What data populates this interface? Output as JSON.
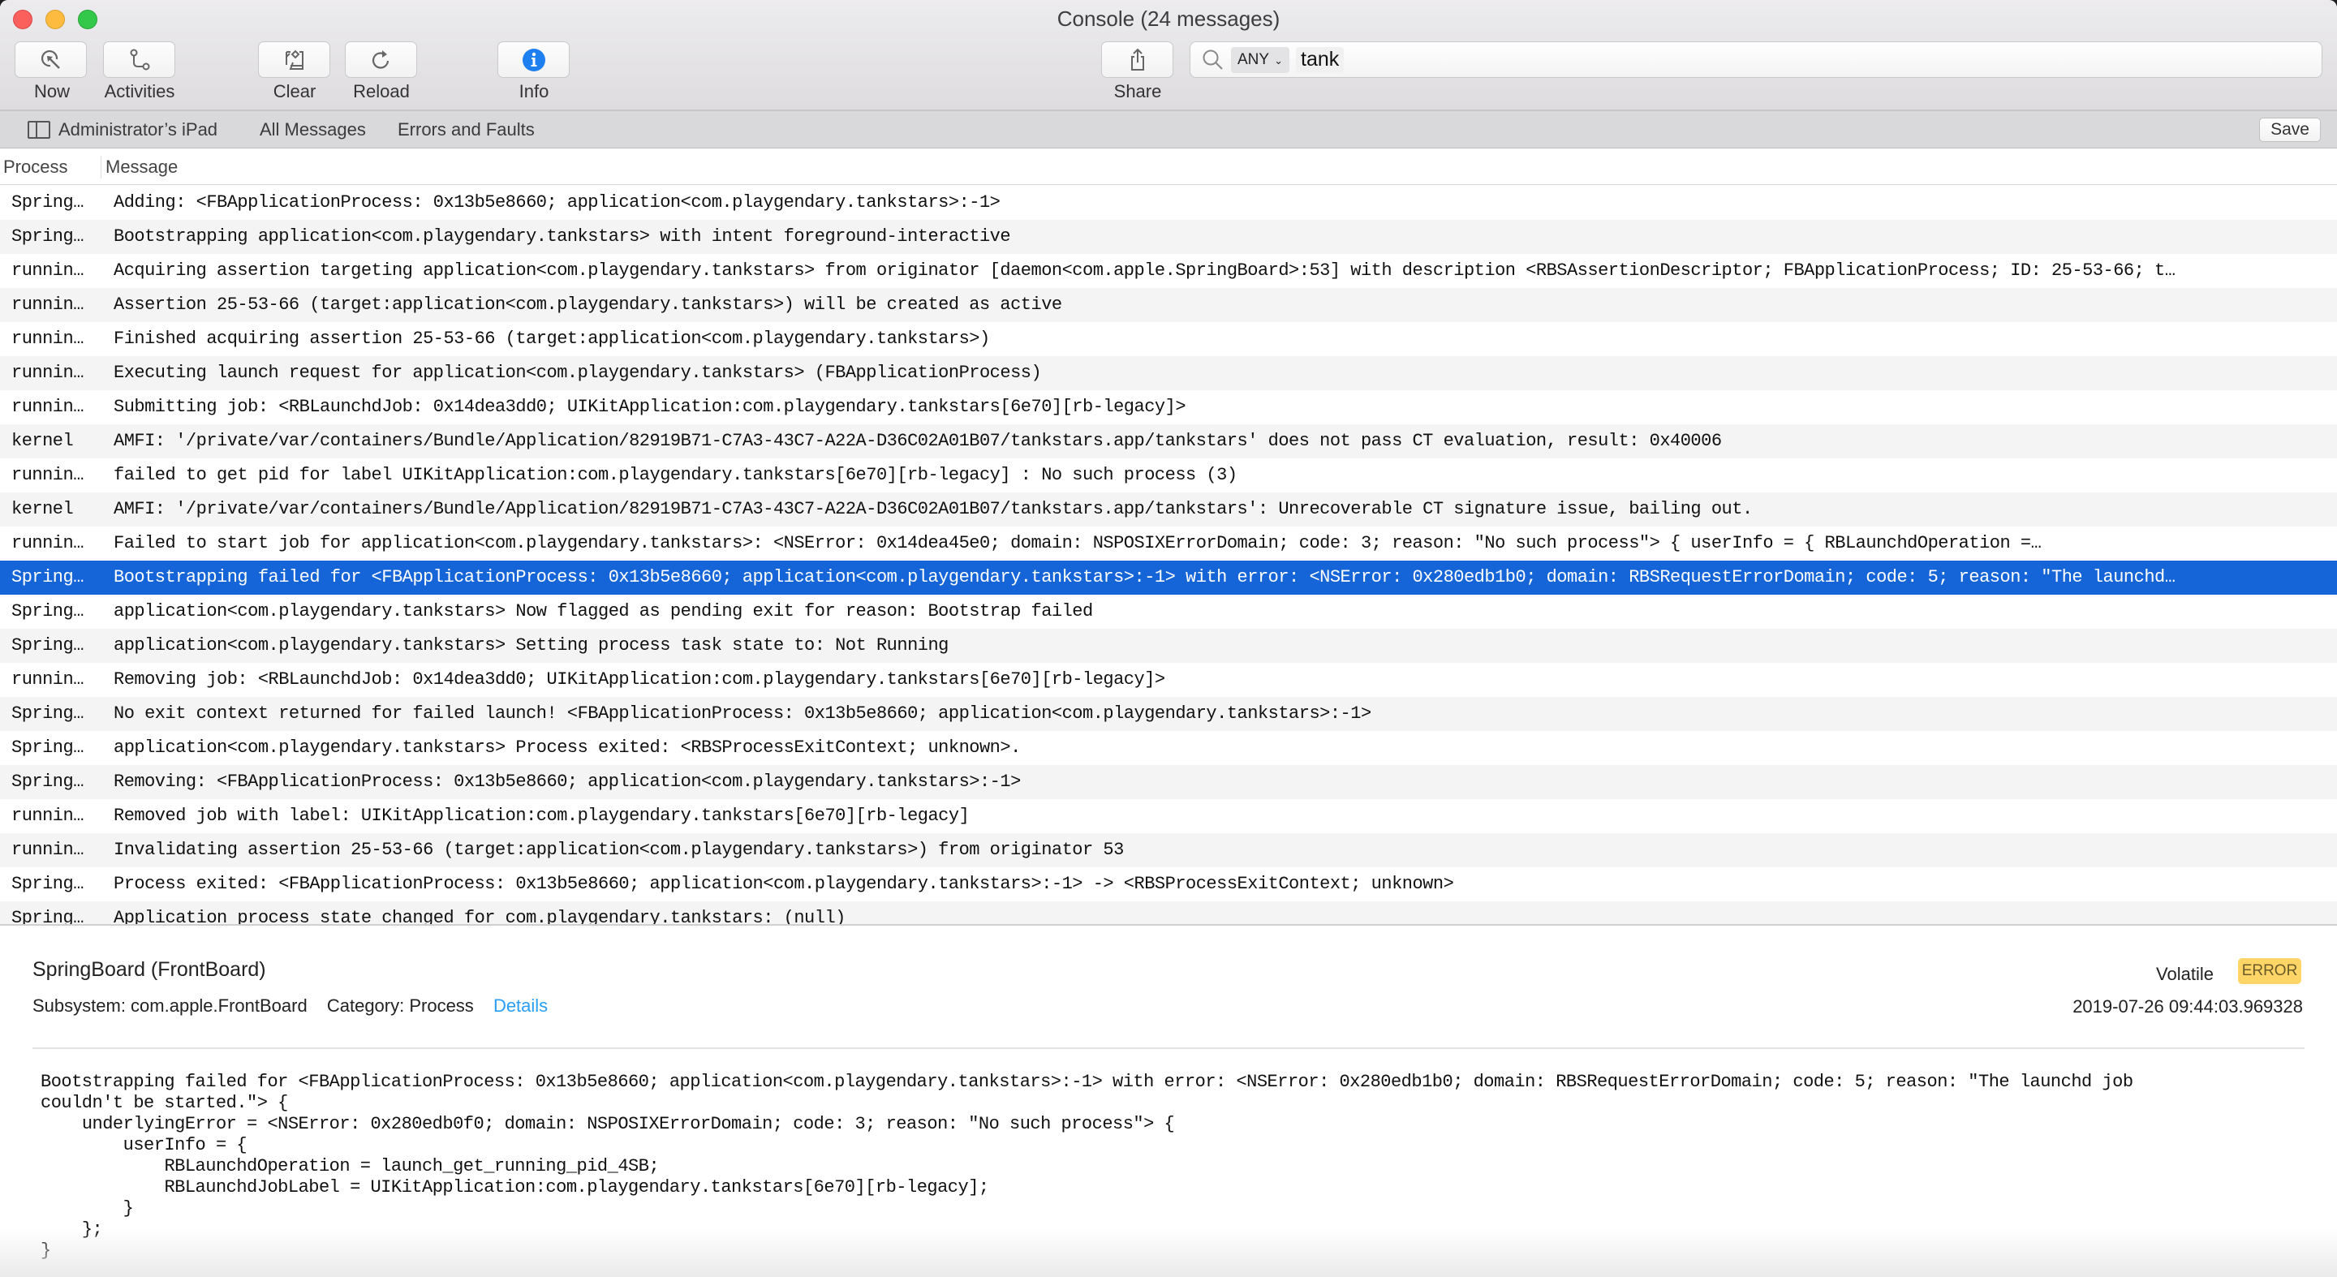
{
  "window": {
    "title": "Console (24 messages)"
  },
  "toolbar": {
    "now_label": "Now",
    "activities_label": "Activities",
    "clear_label": "Clear",
    "reload_label": "Reload",
    "info_label": "Info",
    "share_label": "Share",
    "icons": {
      "now": "now-cursor-icon",
      "activities": "activities-path-icon",
      "clear": "clear-icon",
      "reload": "reload-icon",
      "info": "info-icon",
      "share": "share-icon"
    },
    "accent_color": "#1e7ff0"
  },
  "search": {
    "scope_token": "ANY",
    "query": "tank"
  },
  "filterbar": {
    "device": "Administrator’s iPad",
    "all_messages": "All Messages",
    "errors_and_faults": "Errors and Faults",
    "save_label": "Save"
  },
  "columns": {
    "process": "Process",
    "message": "Message"
  },
  "rows": [
    {
      "process": "Spring…",
      "message": "Adding: <FBApplicationProcess: 0x13b5e8660; application<com.playgendary.tankstars>:-1>"
    },
    {
      "process": "Spring…",
      "message": "Bootstrapping application<com.playgendary.tankstars> with intent foreground-interactive"
    },
    {
      "process": "runnin…",
      "message": "Acquiring assertion targeting application<com.playgendary.tankstars> from originator [daemon<com.apple.SpringBoard>:53] with description <RBSAssertionDescriptor; FBApplicationProcess; ID: 25-53-66; t…"
    },
    {
      "process": "runnin…",
      "message": "Assertion 25-53-66 (target:application<com.playgendary.tankstars>) will be created as active"
    },
    {
      "process": "runnin…",
      "message": "Finished acquiring assertion 25-53-66 (target:application<com.playgendary.tankstars>)"
    },
    {
      "process": "runnin…",
      "message": "Executing launch request for application<com.playgendary.tankstars> (FBApplicationProcess)"
    },
    {
      "process": "runnin…",
      "message": "Submitting job: <RBLaunchdJob: 0x14dea3dd0; UIKitApplication:com.playgendary.tankstars[6e70][rb-legacy]>"
    },
    {
      "process": "kernel",
      "message": "AMFI: '/private/var/containers/Bundle/Application/82919B71-C7A3-43C7-A22A-D36C02A01B07/tankstars.app/tankstars' does not pass CT evaluation, result: 0x40006"
    },
    {
      "process": "runnin…",
      "message": "failed to get pid for label UIKitApplication:com.playgendary.tankstars[6e70][rb-legacy] : No such process (3)"
    },
    {
      "process": "kernel",
      "message": "AMFI: '/private/var/containers/Bundle/Application/82919B71-C7A3-43C7-A22A-D36C02A01B07/tankstars.app/tankstars': Unrecoverable CT signature issue, bailing out."
    },
    {
      "process": "runnin…",
      "message": "Failed to start job for application<com.playgendary.tankstars>: <NSError: 0x14dea45e0; domain: NSPOSIXErrorDomain; code: 3; reason: \"No such process\"> {     userInfo = {         RBLaunchdOperation =…"
    },
    {
      "process": "Spring…",
      "message": "Bootstrapping failed for <FBApplicationProcess: 0x13b5e8660; application<com.playgendary.tankstars>:-1> with error: <NSError: 0x280edb1b0; domain: RBSRequestErrorDomain; code: 5; reason: \"The launchd…",
      "selected": true
    },
    {
      "process": "Spring…",
      "message": "application<com.playgendary.tankstars> Now flagged as pending exit for reason: Bootstrap failed"
    },
    {
      "process": "Spring…",
      "message": "application<com.playgendary.tankstars> Setting process task state to: Not Running"
    },
    {
      "process": "runnin…",
      "message": "Removing job: <RBLaunchdJob: 0x14dea3dd0; UIKitApplication:com.playgendary.tankstars[6e70][rb-legacy]>"
    },
    {
      "process": "Spring…",
      "message": "No exit context returned for failed launch! <FBApplicationProcess: 0x13b5e8660; application<com.playgendary.tankstars>:-1>"
    },
    {
      "process": "Spring…",
      "message": "application<com.playgendary.tankstars> Process exited: <RBSProcessExitContext; unknown>."
    },
    {
      "process": "Spring…",
      "message": "Removing: <FBApplicationProcess: 0x13b5e8660; application<com.playgendary.tankstars>:-1>"
    },
    {
      "process": "runnin…",
      "message": "Removed job with label: UIKitApplication:com.playgendary.tankstars[6e70][rb-legacy]"
    },
    {
      "process": "runnin…",
      "message": "Invalidating assertion 25-53-66 (target:application<com.playgendary.tankstars>) from originator 53"
    },
    {
      "process": "Spring…",
      "message": "Process exited: <FBApplicationProcess: 0x13b5e8660; application<com.playgendary.tankstars>:-1> -> <RBSProcessExitContext; unknown>"
    },
    {
      "process": "Spring…",
      "message": "Application process state changed for com.playgendary.tankstars: (null)"
    }
  ],
  "detail": {
    "title": "SpringBoard (FrontBoard)",
    "subsystem": "Subsystem: com.apple.FrontBoard",
    "category": "Category: Process",
    "details_link": "Details",
    "volatile": "Volatile",
    "level_badge": "ERROR",
    "level_badge_color": "#fed566",
    "timestamp": "2019-07-26 09:44:03.969328",
    "body": "Bootstrapping failed for <FBApplicationProcess: 0x13b5e8660; application<com.playgendary.tankstars>:-1> with error: <NSError: 0x280edb1b0; domain: RBSRequestErrorDomain; code: 5; reason: \"The launchd job\ncouldn't be started.\"> {\n    underlyingError = <NSError: 0x280edb0f0; domain: NSPOSIXErrorDomain; code: 3; reason: \"No such process\"> {\n        userInfo = {\n            RBLaunchdOperation = launch_get_running_pid_4SB;\n            RBLaunchdJobLabel = UIKitApplication:com.playgendary.tankstars[6e70][rb-legacy];\n        }\n    };\n}"
  },
  "colors": {
    "selection": "#1565d8",
    "link": "#2a9df4"
  }
}
